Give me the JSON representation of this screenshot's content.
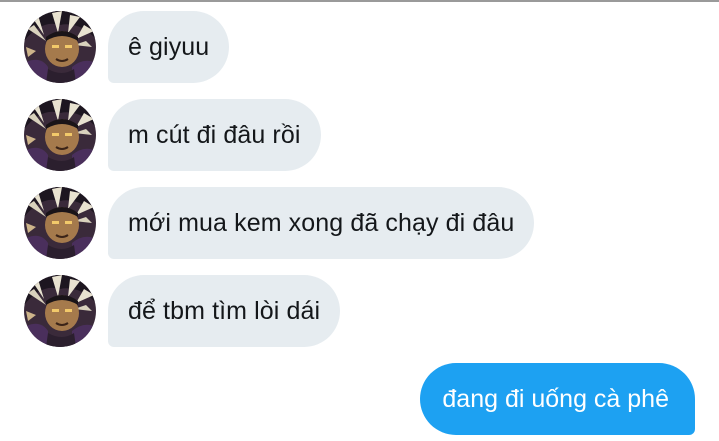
{
  "conversation": {
    "incoming": [
      {
        "text": "ê giyuu",
        "avatar_icon": "contact-avatar"
      },
      {
        "text": "m cút đi đâu rồi",
        "avatar_icon": "contact-avatar"
      },
      {
        "text": "mới mua kem xong đã chạy đi đâu",
        "avatar_icon": "contact-avatar"
      },
      {
        "text": "để tbm tìm lòi dái",
        "avatar_icon": "contact-avatar"
      }
    ],
    "outgoing": [
      {
        "text": "đang đi uống cà phê"
      }
    ]
  },
  "colors": {
    "incoming_bubble": "#e6ecf0",
    "incoming_text": "#14171a",
    "outgoing_bubble": "#1da1f2",
    "outgoing_text": "#ffffff",
    "top_border": "#9a9a9a"
  }
}
